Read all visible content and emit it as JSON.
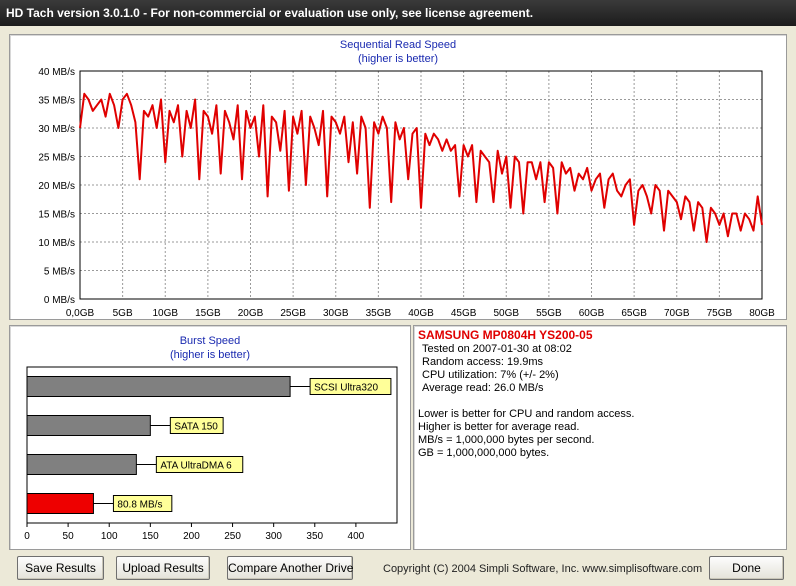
{
  "window": {
    "title": "HD Tach version 3.0.1.0  - For non-commercial or evaluation use only, see license agreement."
  },
  "seq_chart": {
    "title": "Sequential Read Speed",
    "subtitle": "(higher is better)"
  },
  "burst_chart": {
    "title": "Burst Speed",
    "subtitle": "(higher is better)"
  },
  "chart_data": [
    {
      "type": "line",
      "title": "Sequential Read Speed",
      "subtitle": "(higher is better)",
      "y_tick_labels": [
        "0 MB/s",
        "5 MB/s",
        "10 MB/s",
        "15 MB/s",
        "20 MB/s",
        "25 MB/s",
        "30 MB/s",
        "35 MB/s",
        "40 MB/s"
      ],
      "x_tick_labels": [
        "0,0GB",
        "5GB",
        "10GB",
        "15GB",
        "20GB",
        "25GB",
        "30GB",
        "35GB",
        "40GB",
        "45GB",
        "50GB",
        "55GB",
        "60GB",
        "65GB",
        "70GB",
        "75GB",
        "80GB"
      ],
      "xlim": [
        0,
        80
      ],
      "ylim": [
        0,
        40
      ],
      "grid": true,
      "series_color": "#e00000",
      "series": [
        {
          "x": [
            0,
            0.5,
            1,
            1.5,
            2,
            2.5,
            3,
            3.5,
            4,
            4.5,
            5,
            5.5,
            6,
            6.5,
            7,
            7.5,
            8,
            8.5,
            9,
            9.5,
            10,
            10.5,
            11,
            11.5,
            12,
            12.5,
            13,
            13.5,
            14,
            14.5,
            15,
            15.5,
            16,
            16.5,
            17,
            17.5,
            18,
            18.5,
            19,
            19.5,
            20,
            20.5,
            21,
            21.5,
            22,
            22.5,
            23,
            23.5,
            24,
            24.5,
            25,
            25.5,
            26,
            26.5,
            27,
            27.5,
            28,
            28.5,
            29,
            29.5,
            30,
            30.5,
            31,
            31.5,
            32,
            32.5,
            33,
            33.5,
            34,
            34.5,
            35,
            35.5,
            36,
            36.5,
            37,
            37.5,
            38,
            38.5,
            39,
            39.5,
            40,
            40.5,
            41,
            41.5,
            42,
            42.5,
            43,
            43.5,
            44,
            44.5,
            45,
            45.5,
            46,
            46.5,
            47,
            47.5,
            48,
            48.5,
            49,
            49.5,
            50,
            50.5,
            51,
            51.5,
            52,
            52.5,
            53,
            53.5,
            54,
            54.5,
            55,
            55.5,
            56,
            56.5,
            57,
            57.5,
            58,
            58.5,
            59,
            59.5,
            60,
            60.5,
            61,
            61.5,
            62,
            62.5,
            63,
            63.5,
            64,
            64.5,
            65,
            65.5,
            66,
            66.5,
            67,
            67.5,
            68,
            68.5,
            69,
            69.5,
            70,
            70.5,
            71,
            71.5,
            72,
            72.5,
            73,
            73.5,
            74,
            74.5,
            75,
            75.5,
            76,
            76.5,
            77,
            77.5,
            78,
            78.5,
            79,
            79.5,
            80
          ],
          "y": [
            30,
            36,
            35,
            33,
            34,
            35,
            32,
            36,
            34,
            30,
            35,
            36,
            34,
            31,
            21,
            33,
            32,
            34,
            30,
            35,
            24,
            33,
            31,
            34,
            25,
            33,
            30,
            35,
            21,
            33,
            32,
            29,
            34,
            22,
            33,
            31,
            28,
            34,
            21,
            33,
            30,
            32,
            25,
            34,
            18,
            32,
            31,
            26,
            33,
            19,
            32,
            29,
            33,
            20,
            32,
            30,
            27,
            33,
            18,
            32,
            31,
            29,
            32,
            24,
            31,
            22,
            32,
            30,
            16,
            31,
            29,
            32,
            30,
            17,
            31,
            28,
            30,
            21,
            29,
            30,
            16,
            29,
            27,
            29,
            28,
            26,
            28,
            26,
            27,
            18,
            27,
            25,
            27,
            17,
            26,
            25,
            24,
            17,
            26,
            22,
            25,
            16,
            25,
            24,
            15,
            24,
            24,
            21,
            24,
            17,
            24,
            23,
            15,
            24,
            22,
            23,
            19,
            22,
            21,
            23,
            19,
            21,
            22,
            16,
            21,
            22,
            19,
            18,
            20,
            21,
            13,
            19,
            20,
            18,
            15,
            20,
            19,
            12,
            19,
            18,
            17,
            14,
            18,
            17,
            12,
            17,
            16,
            10,
            16,
            15,
            13,
            15,
            11,
            15,
            15,
            12,
            15,
            14,
            12,
            18,
            13
          ]
        }
      ]
    },
    {
      "type": "bar",
      "orientation": "horizontal",
      "title": "Burst Speed",
      "subtitle": "(higher is better)",
      "xlim": [
        0,
        450
      ],
      "x_tick_labels": [
        "0",
        "50",
        "100",
        "150",
        "200",
        "250",
        "300",
        "350",
        "400"
      ],
      "bars": [
        {
          "label": "SCSI Ultra320",
          "value": 320,
          "color": "#808080"
        },
        {
          "label": "SATA 150",
          "value": 150,
          "color": "#808080"
        },
        {
          "label": "ATA UltraDMA 6",
          "value": 133,
          "color": "#808080"
        },
        {
          "label": "80.8 MB/s",
          "value": 80.8,
          "color": "#ee0000"
        }
      ]
    }
  ],
  "info": {
    "drive_name": "SAMSUNG MP0804H YS200-05",
    "tested_on": "Tested on 2007-01-30 at 08:02",
    "random_access": "Random access: 19.9ms",
    "cpu_utilization": "CPU utilization: 7% (+/- 2%)",
    "average_read": "Average read: 26.0 MB/s",
    "notes": [
      "Lower is better for CPU and random access.",
      "Higher is better for average read.",
      "MB/s = 1,000,000 bytes per second.",
      "GB = 1,000,000,000 bytes."
    ]
  },
  "buttons": {
    "save": "Save Results",
    "upload": "Upload Results",
    "compare": "Compare Another Drive",
    "done": "Done"
  },
  "footer": {
    "copyright": "Copyright (C) 2004 Simpli Software, Inc. www.simplisoftware.com"
  }
}
